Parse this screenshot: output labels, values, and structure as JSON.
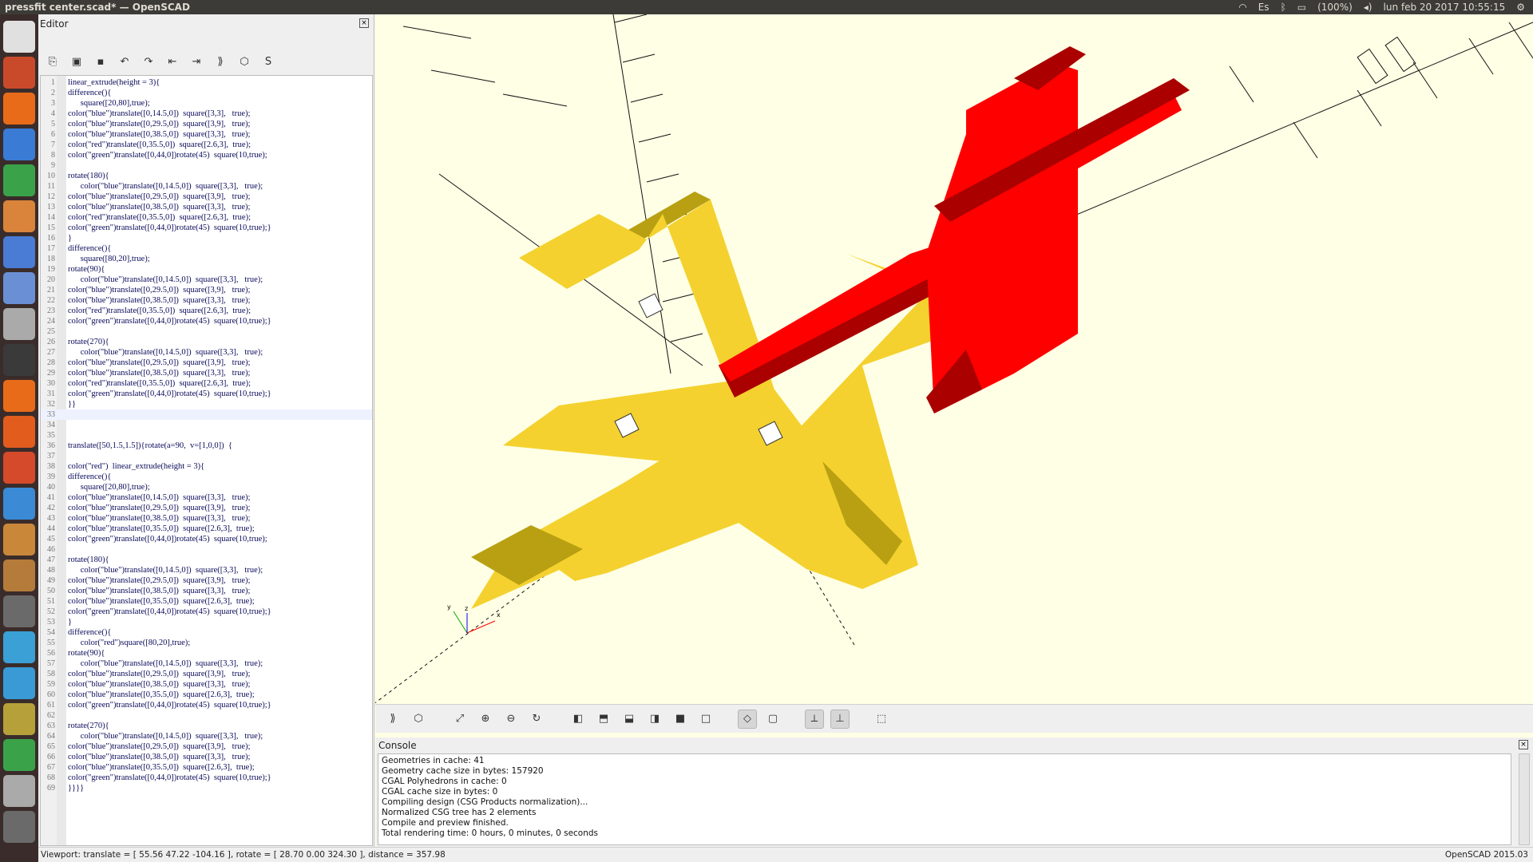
{
  "window": {
    "title": "pressfit center.scad* — OpenSCAD"
  },
  "tray": {
    "lang": "Es",
    "battery": "(100%)",
    "datetime": "lun feb 20 2017 10:55:15"
  },
  "editor": {
    "title": "Editor",
    "toolbar": [
      "new-icon",
      "open-icon",
      "save-icon",
      "undo-icon",
      "redo-icon",
      "unindent-icon",
      "indent-icon",
      "preview-icon",
      "render-icon",
      "stl-icon"
    ],
    "lines": [
      "linear_extrude(height = 3){",
      "difference(){",
      "      square([20,80],true);",
      "color(\"blue\")translate([0,14.5,0])  square([3,3],   true);",
      "color(\"blue\")translate([0,29.5,0])  square([3,9],   true);",
      "color(\"blue\")translate([0,38.5,0])  square([3,3],   true);",
      "color(\"red\")translate([0,35.5,0])  square([2.6,3],  true);",
      "color(\"green\")translate([0,44,0])rotate(45)  square(10,true);",
      "",
      "rotate(180){",
      "      color(\"blue\")translate([0,14.5,0])  square([3,3],   true);",
      "color(\"blue\")translate([0,29.5,0])  square([3,9],   true);",
      "color(\"blue\")translate([0,38.5,0])  square([3,3],   true);",
      "color(\"red\")translate([0,35.5,0])  square([2.6,3],  true);",
      "color(\"green\")translate([0,44,0])rotate(45)  square(10,true);}",
      "}",
      "difference(){",
      "      square([80,20],true);",
      "rotate(90){",
      "      color(\"blue\")translate([0,14.5,0])  square([3,3],   true);",
      "color(\"blue\")translate([0,29.5,0])  square([3,9],   true);",
      "color(\"blue\")translate([0,38.5,0])  square([3,3],   true);",
      "color(\"red\")translate([0,35.5,0])  square([2.6,3],  true);",
      "color(\"green\")translate([0,44,0])rotate(45)  square(10,true);}",
      "",
      "rotate(270){",
      "      color(\"blue\")translate([0,14.5,0])  square([3,3],   true);",
      "color(\"blue\")translate([0,29.5,0])  square([3,9],   true);",
      "color(\"blue\")translate([0,38.5,0])  square([3,3],   true);",
      "color(\"red\")translate([0,35.5,0])  square([2.6,3],  true);",
      "color(\"green\")translate([0,44,0])rotate(45)  square(10,true);}",
      "}}",
      "",
      "",
      "",
      "translate([50,1.5,1.5]){rotate(a=90,  v=[1,0,0])  {",
      "",
      "color(\"red\")  linear_extrude(height = 3){",
      "difference(){",
      "      square([20,80],true);",
      "color(\"blue\")translate([0,14.5,0])  square([3,3],   true);",
      "color(\"blue\")translate([0,29.5,0])  square([3,9],   true);",
      "color(\"blue\")translate([0,38.5,0])  square([3,3],   true);",
      "color(\"blue\")translate([0,35.5,0])  square([2.6,3],  true);",
      "color(\"green\")translate([0,44,0])rotate(45)  square(10,true);",
      "",
      "rotate(180){",
      "      color(\"blue\")translate([0,14.5,0])  square([3,3],   true);",
      "color(\"blue\")translate([0,29.5,0])  square([3,9],   true);",
      "color(\"blue\")translate([0,38.5,0])  square([3,3],   true);",
      "color(\"blue\")translate([0,35.5,0])  square([2.6,3],  true);",
      "color(\"green\")translate([0,44,0])rotate(45)  square(10,true);}",
      "}",
      "difference(){",
      "      color(\"red\")square([80,20],true);",
      "rotate(90){",
      "      color(\"blue\")translate([0,14.5,0])  square([3,3],   true);",
      "color(\"blue\")translate([0,29.5,0])  square([3,9],   true);",
      "color(\"blue\")translate([0,38.5,0])  square([3,3],   true);",
      "color(\"blue\")translate([0,35.5,0])  square([2.6,3],  true);",
      "color(\"green\")translate([0,44,0])rotate(45)  square(10,true);}",
      "",
      "rotate(270){",
      "      color(\"blue\")translate([0,14.5,0])  square([3,3],   true);",
      "color(\"blue\")translate([0,29.5,0])  square([3,9],   true);",
      "color(\"blue\")translate([0,38.5,0])  square([3,3],   true);",
      "color(\"blue\")translate([0,35.5,0])  square([2.6,3],  true);",
      "color(\"green\")translate([0,44,0])rotate(45)  square(10,true);}",
      "}}}}"
    ],
    "current_line": 33
  },
  "viewport": {
    "axis_labels": {
      "x": "x",
      "y": "y",
      "z": "z"
    },
    "colors": {
      "yellow": "#f4d12e",
      "yellow_shade": "#b8a012",
      "red": "#ff0000",
      "red_shade": "#aa0000"
    }
  },
  "view_toolbar": [
    "preview-icon",
    "render-icon",
    "view-all-icon",
    "zoom-in-icon",
    "zoom-out-icon",
    "reset-view-icon",
    "view-right-icon",
    "view-top-icon",
    "view-bottom-icon",
    "view-left-icon",
    "view-front-icon",
    "view-back-icon",
    "perspective-icon",
    "orthogonal-icon",
    "show-axes-icon",
    "show-scale-icon",
    "show-edges-icon"
  ],
  "console": {
    "title": "Console",
    "lines": [
      "Geometries in cache: 41",
      "Geometry cache size in bytes: 157920",
      "CGAL Polyhedrons in cache: 0",
      "CGAL cache size in bytes: 0",
      "Compiling design (CSG Products normalization)...",
      "Normalized CSG tree has 2 elements",
      "Compile and preview finished.",
      "Total rendering time: 0 hours, 0 minutes, 0 seconds"
    ]
  },
  "status": {
    "viewport": "Viewport: translate = [ 55.56 47.22 -104.16 ], rotate = [ 28.70 0.00 324.30 ], distance = 357.98",
    "version": "OpenSCAD 2015.03"
  }
}
